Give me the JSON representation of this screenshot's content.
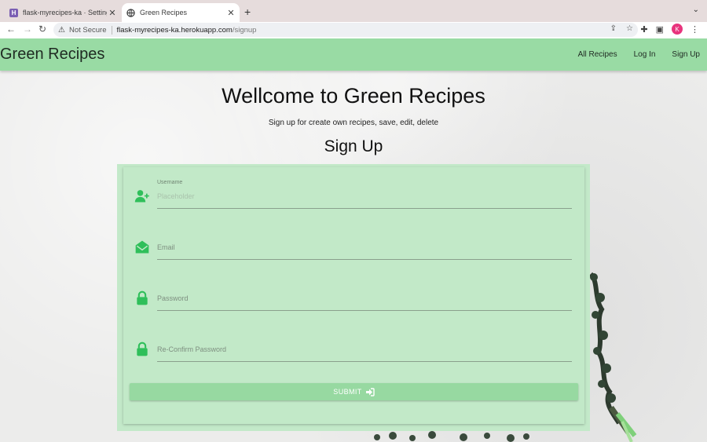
{
  "browser": {
    "tabs": [
      {
        "title": "flask-myrecipes-ka · Settings |",
        "active": false
      },
      {
        "title": "Green Recipes",
        "active": true
      }
    ],
    "new_tab": "+",
    "security_label": "Not Secure",
    "url_host": "flask-myrecipes-ka.herokuapp.com",
    "url_path": "/signup",
    "profile_initial": "K"
  },
  "navbar": {
    "brand": "Green Recipes",
    "links": [
      "All Recipes",
      "Log In",
      "Sign Up"
    ],
    "color": "#99dba4"
  },
  "page": {
    "welcome": "Wellcome to Green Recipes",
    "subtitle": "Sign up for create own recipes, save, edit, delete",
    "form_title": "Sign Up"
  },
  "form": {
    "username": {
      "label": "Username",
      "placeholder": "Placeholder",
      "icon": "add-user-icon"
    },
    "email": {
      "label": "Email",
      "icon": "envelope-icon"
    },
    "password": {
      "label": "Password",
      "icon": "lock-icon"
    },
    "confirm": {
      "label": "Re-Confirm Password",
      "icon": "lock-icon"
    },
    "submit_label": "SUBMIT",
    "accent": "#2fbf5a"
  }
}
